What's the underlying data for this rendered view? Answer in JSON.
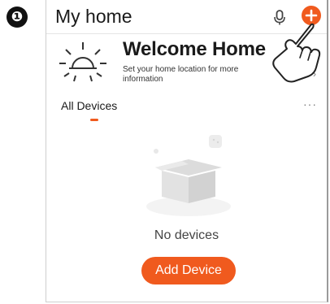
{
  "step": {
    "number": "❶"
  },
  "header": {
    "title": "My home"
  },
  "welcome": {
    "title": "Welcome Home",
    "subtitle": "Set your home location for more information",
    "chevron": "›"
  },
  "tabs": [
    {
      "label": "All Devices",
      "selected": true
    }
  ],
  "more_menu": {
    "label": "···"
  },
  "empty_state": {
    "text": "No devices"
  },
  "actions": {
    "add_device_label": "Add Device"
  },
  "icons": {
    "mic": "microphone-icon",
    "add": "plus-circle-icon",
    "sun": "sun-icon",
    "pointer": "hand-pointer-icon",
    "empty": "empty-box-icon"
  },
  "colors": {
    "accent": "#f05a1e",
    "text": "#1a1a1a"
  }
}
